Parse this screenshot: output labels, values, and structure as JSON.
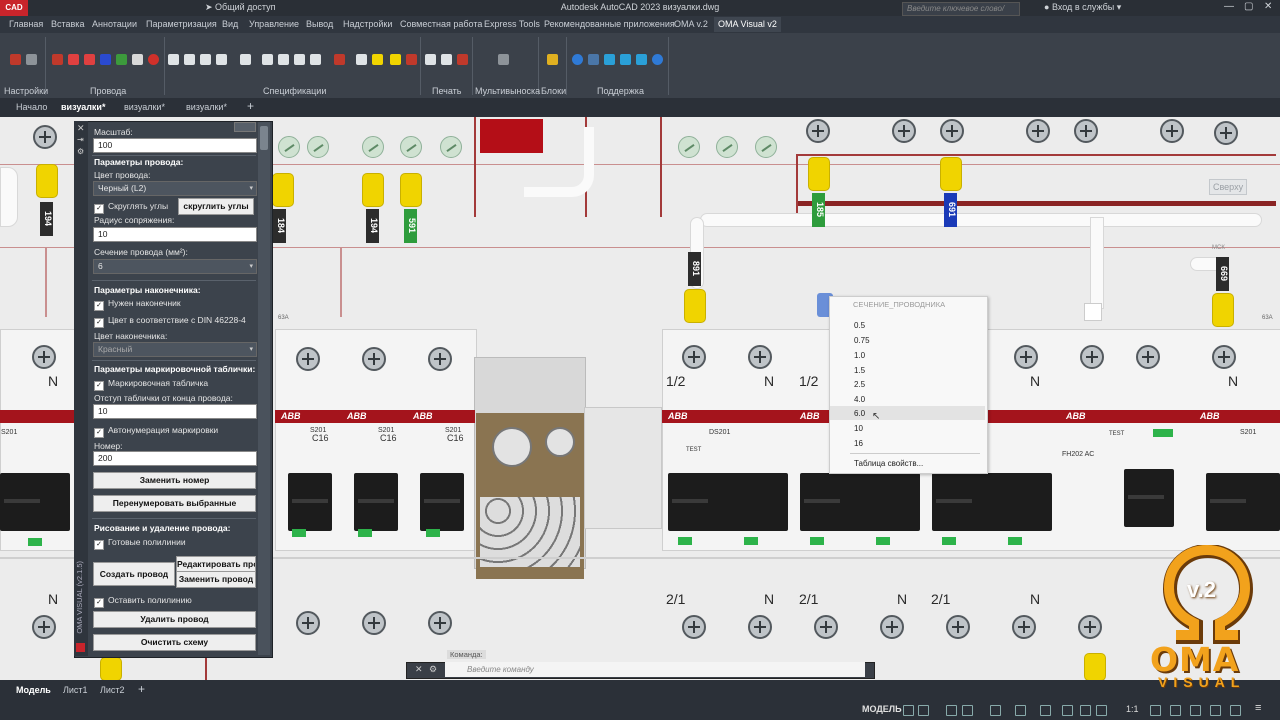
{
  "app": {
    "logo_text": "CAD",
    "title": "Autodesk AutoCAD 2023   визуалки.dwg",
    "share": "Общий доступ",
    "search_placeholder": "Введите ключевое слово/фразу",
    "login": "Вход в службы",
    "colors": {
      "accent_red": "#c8242b",
      "abb_red": "#a4141c",
      "ferrule_yellow": "#f0d400",
      "rail_red": "#a33a3a",
      "logo_orange": "#f2a21c"
    }
  },
  "ribbon": {
    "tabs": [
      "Главная",
      "Вставка",
      "Аннотации",
      "Параметризация",
      "Вид",
      "Управление",
      "Вывод",
      "Надстройки",
      "Совместная работа",
      "Express Tools",
      "Рекомендованные приложения",
      "OMA v.2",
      "OMA Visual v2"
    ],
    "active_tab": "OMA Visual v2",
    "groups": [
      "Настройки",
      "Провода",
      "Спецификации",
      "Печать",
      "Мультивыноска",
      "Блоки",
      "Поддержка"
    ]
  },
  "doc_tabs": [
    "Начало",
    "визуалки*",
    "визуалки*",
    "визуалки*"
  ],
  "doc_tab_add": "+",
  "panel": {
    "vertical_title": "OMA VISUAL (v2.1.5)",
    "scale_label": "Масштаб:",
    "scale_value": "100",
    "wire_params_header": "Параметры провода:",
    "wire_color_label": "Цвет провода:",
    "wire_color_value": "Черный (L2)",
    "round_corners_check": "Скруглять углы",
    "round_corners_button": "скруглить углы",
    "radius_label": "Радиус сопряжения:",
    "radius_value": "10",
    "section_label": "Сечение провода (мм²):",
    "section_value": "6",
    "ferrule_header": "Параметры наконечника:",
    "need_ferrule": "Нужен наконечник",
    "din_color": "Цвет в соответствие с DIN 46228-4",
    "ferrule_color_label": "Цвет наконечника:",
    "ferrule_color_value": "Красный",
    "marker_header": "Параметры маркировочной таблички:",
    "marker_plate": "Маркировочная табличка",
    "offset_label": "Отступ таблички от конца провода:",
    "offset_value": "10",
    "autonumber": "Автонумерация маркировки",
    "number_label": "Номер:",
    "number_value": "200",
    "replace_number_btn": "Заменить номер",
    "renumber_btn": "Перенумеровать выбранные",
    "draw_header": "Рисование и удаление провода:",
    "ready_polylines": "Готовые полилинии",
    "create_wire_btn": "Создать провод",
    "edit_wire_btn": "Редактировать провод",
    "replace_wire_btn": "Заменить провод",
    "keep_polyline": "Оставить полилинию",
    "delete_wire_btn": "Удалить провод",
    "clear_scheme_btn": "Очистить схему"
  },
  "popup": {
    "title": "СЕЧЕНИЕ_ПРОВОДНИКА",
    "options": [
      "0.5",
      "0.75",
      "1.0",
      "1.5",
      "2.5",
      "4.0",
      "6.0",
      "10",
      "16"
    ],
    "highlighted": "6.0",
    "footer": "Таблица свойств..."
  },
  "drawing": {
    "markers_top": [
      "194",
      "184",
      "194",
      "591",
      "185",
      "691",
      "891",
      "669"
    ],
    "brand": "ABB",
    "breaker_model": "S201",
    "breaker_rating": "C16",
    "rcd_model": "DS201",
    "rcd_model2": "FH202 AC",
    "test_label": "TEST",
    "terminal_labels": [
      "1/2",
      "N",
      "1/2",
      "N",
      "2/1",
      "N",
      "2/1",
      "N",
      "2/1",
      "N",
      "N"
    ],
    "rating_tag": "63A",
    "viewcube": "Сверху",
    "msk": "МСК"
  },
  "command": {
    "label": "Команда:",
    "placeholder": "Введите команду"
  },
  "layout_tabs": [
    "Модель",
    "Лист1",
    "Лист2"
  ],
  "layout_add": "+",
  "status": {
    "model": "МОДЕЛЬ",
    "scale": "1:1"
  },
  "logo": {
    "badge": "v.2",
    "name": "OMA",
    "sub": "VISUAL"
  }
}
